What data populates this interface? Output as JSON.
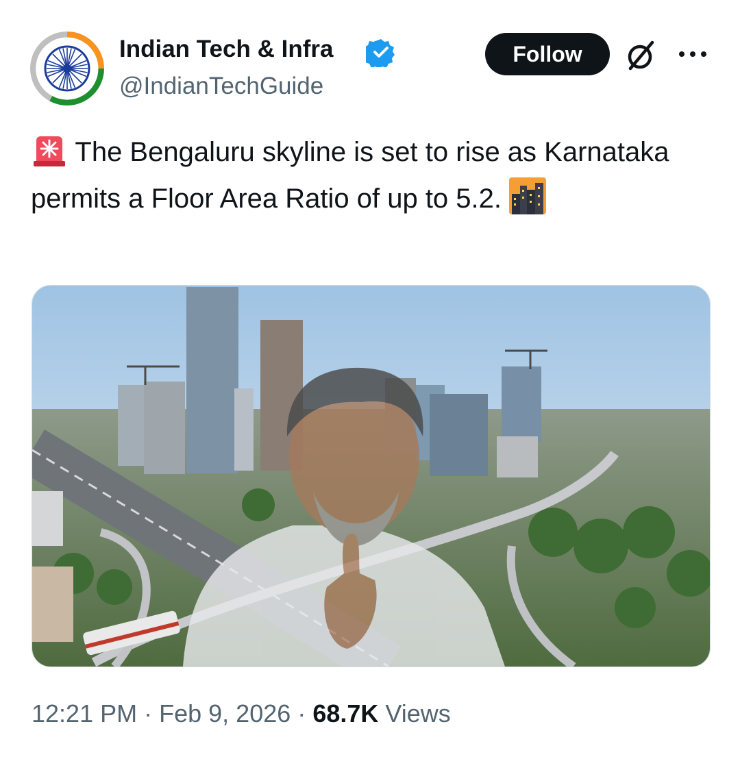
{
  "author": {
    "display_name": "Indian Tech & Infra",
    "handle": "@IndianTechGuide",
    "verified_icon": "verified-badge-icon",
    "avatar_icon": "ashoka-chakra-logo"
  },
  "actions": {
    "follow_label": "Follow",
    "grok_icon": "grok-icon",
    "more_icon": "more-icon"
  },
  "tweet": {
    "leading_emoji": "rotating-light-emoji",
    "text": "The Bengaluru skyline is set to rise as Karnataka permits a Floor Area Ratio of up to 5.2.",
    "trailing_emoji": "city-dusk-emoji"
  },
  "media": {
    "description_icon": "skyline-photo-with-politician"
  },
  "meta": {
    "time": "12:21 PM",
    "separator": "·",
    "date": "Feb 9, 2026",
    "views_count": "68.7K",
    "views_label": "Views"
  },
  "colors": {
    "verified": "#1d9bf0",
    "follow_bg": "#0f1419",
    "secondary_text": "#536471"
  }
}
